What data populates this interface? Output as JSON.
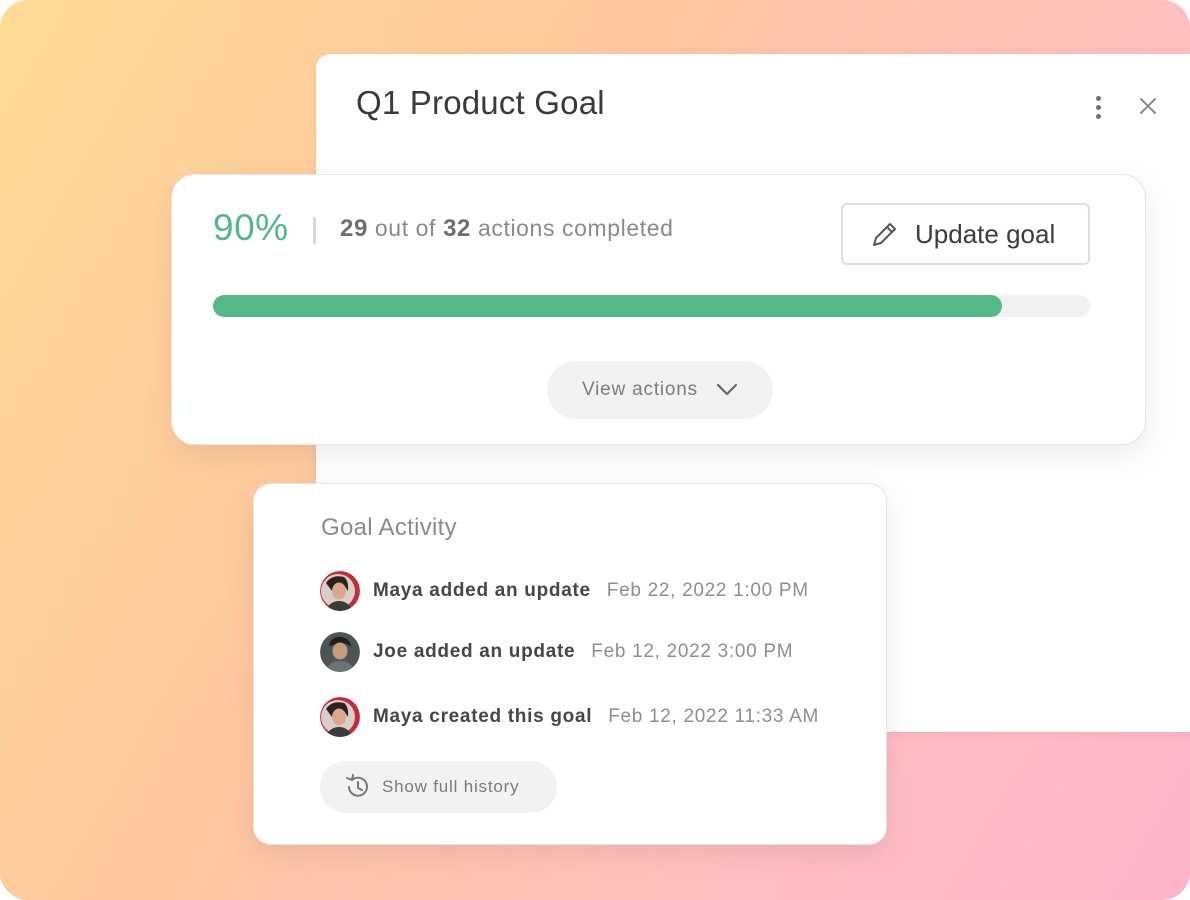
{
  "goal": {
    "title": "Q1 Product Goal",
    "more_icon": "more-vertical-icon",
    "close_icon": "close-icon"
  },
  "progress": {
    "percent_label": "90%",
    "percent_value": 90,
    "completed": "29",
    "middle_text": "out of",
    "total": "32",
    "suffix_text": "actions completed",
    "update_button_label": "Update goal",
    "update_icon": "pencil-icon",
    "view_actions_label": "View actions",
    "view_actions_icon": "chevron-down-icon",
    "colors": {
      "accent": "#55b689",
      "track": "#f1f1f1"
    }
  },
  "activity": {
    "title": "Goal Activity",
    "items": [
      {
        "text": "Maya added an update",
        "time": "Feb 22, 2022 1:00 PM",
        "user": "Maya"
      },
      {
        "text": "Joe added an update",
        "time": "Feb 12, 2022 3:00 PM",
        "user": "Joe"
      },
      {
        "text": "Maya created this goal",
        "time": "Feb 12, 2022 11:33 AM",
        "user": "Maya"
      }
    ],
    "history_button_label": "Show full history",
    "history_icon": "history-icon"
  }
}
